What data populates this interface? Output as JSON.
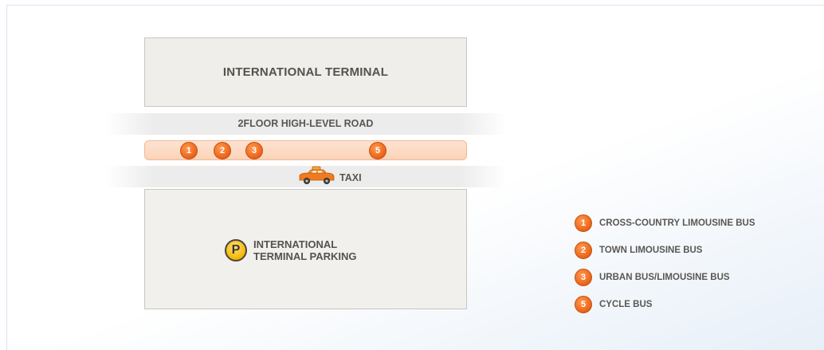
{
  "terminal": {
    "title": "INTERNATIONAL TERMINAL"
  },
  "roads": {
    "high_level": "2FLOOR HIGH-LEVEL ROAD",
    "taxi": "TAXI"
  },
  "bus_stops": [
    {
      "number": "1"
    },
    {
      "number": "2"
    },
    {
      "number": "3"
    },
    {
      "number": "5"
    }
  ],
  "parking": {
    "symbol": "P",
    "line1": "INTERNATIONAL",
    "line2": "TERMINAL PARKING"
  },
  "legend": [
    {
      "number": "1",
      "label": "CROSS-COUNTRY LIMOUSINE BUS"
    },
    {
      "number": "2",
      "label": "TOWN LIMOUSINE BUS"
    },
    {
      "number": "3",
      "label": "URBAN BUS/LIMOUSINE BUS"
    },
    {
      "number": "5",
      "label": "CYCLE BUS"
    }
  ],
  "colors": {
    "bus_stop": "#ee6a1f",
    "bus_lane": "#fbd3b8",
    "parking_symbol": "#f3b500",
    "taxi": "#f07a1e"
  },
  "icons": {
    "taxi": "taxi-icon",
    "parking": "parking-icon",
    "bus_stop": "bus-stop-marker"
  }
}
